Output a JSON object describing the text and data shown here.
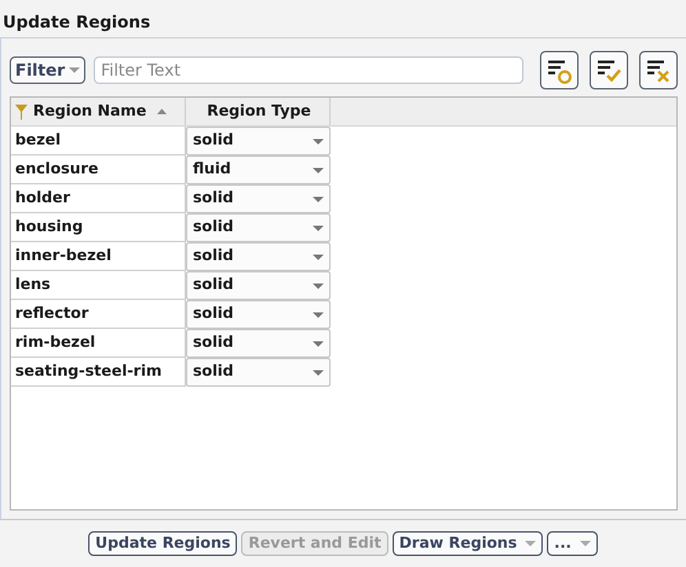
{
  "title": "Update Regions",
  "filter": {
    "menu_label": "Filter",
    "placeholder": "Filter Text"
  },
  "toolbar": [
    {
      "kind": "circle"
    },
    {
      "kind": "check"
    },
    {
      "kind": "cross"
    }
  ],
  "table": {
    "columns": [
      {
        "label": "Region Name",
        "sorted": true,
        "filter": true
      },
      {
        "label": "Region Type",
        "sorted": false,
        "filter": false
      }
    ],
    "rows": [
      {
        "name": "bezel",
        "type": "solid"
      },
      {
        "name": "enclosure",
        "type": "fluid"
      },
      {
        "name": "holder",
        "type": "solid"
      },
      {
        "name": "housing",
        "type": "solid"
      },
      {
        "name": "inner-bezel",
        "type": "solid"
      },
      {
        "name": "lens",
        "type": "solid"
      },
      {
        "name": "reflector",
        "type": "solid"
      },
      {
        "name": "rim-bezel",
        "type": "solid"
      },
      {
        "name": "seating-steel-rim",
        "type": "solid"
      }
    ]
  },
  "buttons": [
    {
      "label": "Update Regions",
      "disabled": false,
      "dropdown": false
    },
    {
      "label": "Revert and Edit",
      "disabled": true,
      "dropdown": false
    },
    {
      "label": "Draw Regions",
      "disabled": false,
      "dropdown": true
    },
    {
      "label": "...",
      "disabled": false,
      "dropdown": true
    }
  ]
}
